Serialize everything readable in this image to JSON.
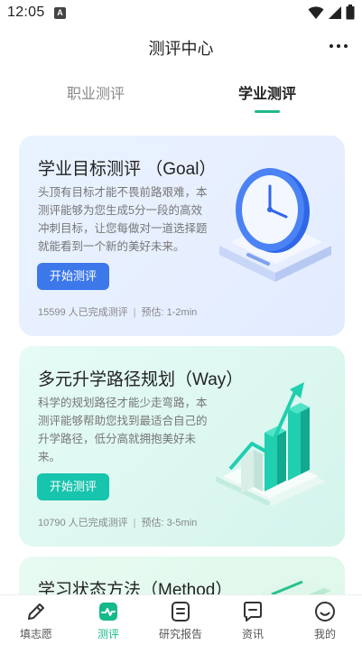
{
  "status_bar": {
    "time": "12:05",
    "badge": "A",
    "icons": [
      "wifi-icon",
      "signal-icon",
      "battery-icon"
    ]
  },
  "header": {
    "title": "测评中心",
    "menu_icon": "more-icon"
  },
  "tabs": [
    {
      "label": "职业测评",
      "active": false
    },
    {
      "label": "学业测评",
      "active": true
    }
  ],
  "cards": [
    {
      "title": "学业目标测评 （Goal）",
      "description": "头顶有目标才能不畏前路艰难，本测评能够为您生成5分一段的高效冲刺目标，让您每做对一道选择题就能看到一个新的美好未来。",
      "button": "开始测评",
      "completed": "15599 人已完成测评",
      "estimate": "预估: 1-2min",
      "illustration": "clock-icon"
    },
    {
      "title": "多元升学路径规划（Way）",
      "description": "科学的规划路径才能少走弯路，本测评能够帮助您找到最适合自己的升学路径，低分高就拥抱美好未来。",
      "button": "开始测评",
      "completed": "10790 人已完成测评",
      "estimate": "预估: 3-5min",
      "illustration": "growth-chart-icon"
    },
    {
      "title": "学习状态方法（Method）",
      "illustration": "books-icon"
    }
  ],
  "bottom_nav": [
    {
      "label": "填志愿",
      "icon": "pen-icon",
      "active": false
    },
    {
      "label": "测评",
      "icon": "assessment-icon",
      "active": true
    },
    {
      "label": "研究报告",
      "icon": "report-icon",
      "active": false
    },
    {
      "label": "资讯",
      "icon": "news-icon",
      "active": false
    },
    {
      "label": "我的",
      "icon": "smile-icon",
      "active": false
    }
  ],
  "colors": {
    "accent_green": "#16b98a",
    "button_blue": "#3c78ea",
    "button_teal": "#17c4ad"
  }
}
